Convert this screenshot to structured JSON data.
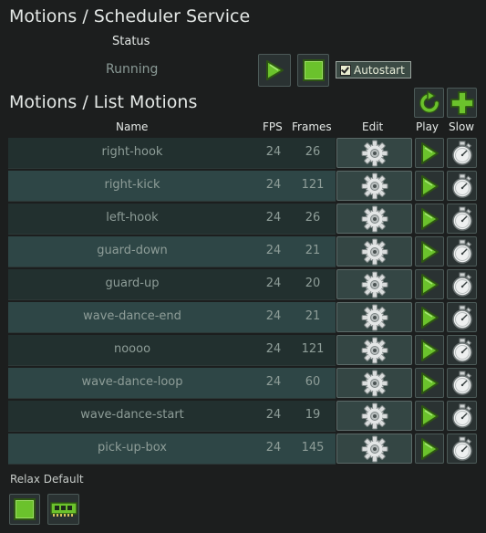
{
  "scheduler": {
    "title": "Motions / Scheduler Service",
    "status_label": "Status",
    "status_value": "Running",
    "autostart_label": "Autostart",
    "autostart_checked": true
  },
  "list": {
    "title": "Motions / List Motions",
    "columns": {
      "name": "Name",
      "fps": "FPS",
      "frames": "Frames",
      "edit": "Edit",
      "play": "Play",
      "slow": "Slow"
    },
    "rows": [
      {
        "name": "right-hook",
        "fps": "24",
        "frames": "26"
      },
      {
        "name": "right-kick",
        "fps": "24",
        "frames": "121"
      },
      {
        "name": "left-hook",
        "fps": "24",
        "frames": "26"
      },
      {
        "name": "guard-down",
        "fps": "24",
        "frames": "21"
      },
      {
        "name": "guard-up",
        "fps": "24",
        "frames": "20"
      },
      {
        "name": "wave-dance-end",
        "fps": "24",
        "frames": "21"
      },
      {
        "name": "noooo",
        "fps": "24",
        "frames": "121"
      },
      {
        "name": "wave-dance-loop",
        "fps": "24",
        "frames": "60"
      },
      {
        "name": "wave-dance-start",
        "fps": "24",
        "frames": "19"
      },
      {
        "name": "pick-up-box",
        "fps": "24",
        "frames": "145"
      }
    ]
  },
  "relax": {
    "label": "Relax Default"
  },
  "icons": {
    "play": "play-icon",
    "stop": "stop-icon",
    "refresh": "refresh-icon",
    "add": "add-icon",
    "edit": "gear-icon",
    "slow": "stopwatch-icon",
    "ram": "memory-chip-icon"
  },
  "colors": {
    "accent_green": "#6bc22c",
    "background": "#1c1e1e",
    "row_dark": "#22302f",
    "row_light": "#2e4646"
  }
}
